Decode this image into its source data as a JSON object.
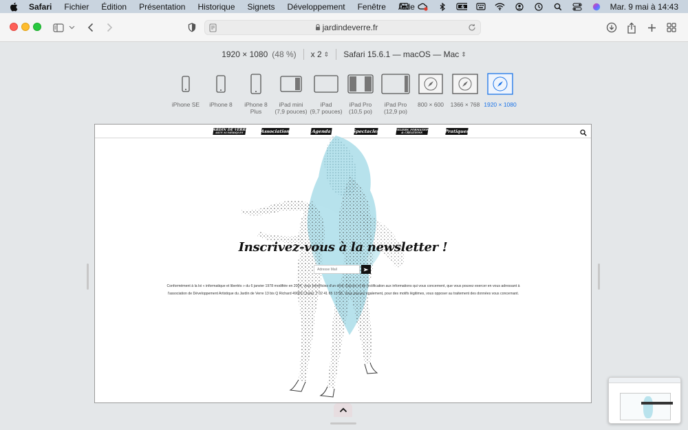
{
  "menubar": {
    "app_name": "Safari",
    "items": [
      "Fichier",
      "Édition",
      "Présentation",
      "Historique",
      "Signets",
      "Développement",
      "Fenêtre",
      "Aide"
    ],
    "clock": "Mar. 9 mai à 14:43"
  },
  "browser": {
    "url": "jardindeverre.fr"
  },
  "rdm": {
    "resolution": "1920 × 1080",
    "zoom": "(48 %)",
    "scale": "x 2",
    "user_agent": "Safari 15.6.1 — macOS — Mac"
  },
  "devices": [
    {
      "name": "iPhone SE",
      "line2": ""
    },
    {
      "name": "iPhone 8",
      "line2": ""
    },
    {
      "name": "iPhone 8",
      "line2": "Plus"
    },
    {
      "name": "iPad mini",
      "line2": "(7,9 pouces)"
    },
    {
      "name": "iPad",
      "line2": "(9,7 pouces)"
    },
    {
      "name": "iPad Pro",
      "line2": "(10,5 po)"
    },
    {
      "name": "iPad Pro",
      "line2": "(12,9 po)"
    },
    {
      "name": "800 × 600",
      "line2": ""
    },
    {
      "name": "1366 × 768",
      "line2": ""
    },
    {
      "name": "1920 × 1080",
      "line2": ""
    }
  ],
  "site": {
    "nav": {
      "logo_line1": "JARDIN DE VERRE",
      "logo_line2": "ARTS NUMÉRIQUES",
      "items": [
        "Association",
        "Agenda",
        "Spectacles",
        "Pratiques"
      ],
      "ateliers_line1": "ATELIERS, FORMATIONS",
      "ateliers_line2": "& CRÉATIONS"
    },
    "newsletter_title": "Inscrivez-vous à la newsletter !",
    "email_placeholder": "Adresse Mail",
    "legal_text": "Conformément à la loi « informatique et libertés » du 6 janvier 1978 modifiée en 2004, vous bénéficiez d'un droit d'accès et de rectification aux informations qui vous concernent, que vous pouvez exercer en vous adressant à l'association de Développement Artistique du Jardin de Verre 13 bis Q Richard 49000 Cholet. T 02 41 65 13 58. Vous pouvez également, pour des motifs légitimes, vous opposer au traitement des données vous concernant."
  },
  "colors": {
    "accent": "#1a73e8",
    "art_tint": "#9fd8e6",
    "menubar": "#c9d4df"
  }
}
